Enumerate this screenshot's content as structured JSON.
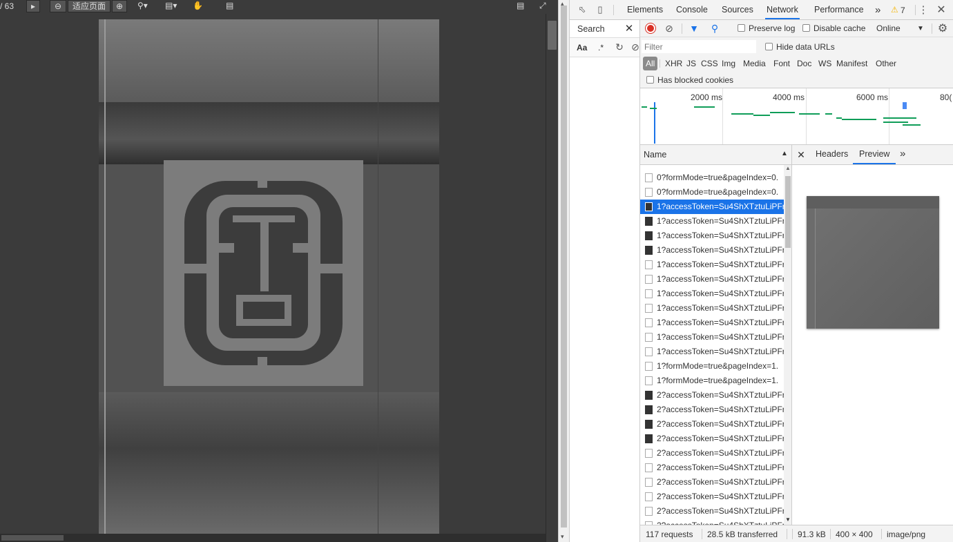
{
  "viewer": {
    "page_indicator": "/ 63",
    "zoom_mode": "适应页面"
  },
  "devtools": {
    "tabs": [
      "Elements",
      "Console",
      "Sources",
      "Network",
      "Performance"
    ],
    "active_tab": "Network",
    "more_tabs": "»",
    "warning_count": "7",
    "search_pane": {
      "title": "Search",
      "case_toggle": "Aa",
      "regex_toggle": ".*"
    },
    "network": {
      "preserve_log_label": "Preserve log",
      "disable_cache_label": "Disable cache",
      "throttling": "Online",
      "filter_placeholder": "Filter",
      "hide_data_urls_label": "Hide data URLs",
      "types": [
        "All",
        "XHR",
        "JS",
        "CSS",
        "Img",
        "Media",
        "Font",
        "Doc",
        "WS",
        "Manifest",
        "Other"
      ],
      "active_type": "All",
      "blocked_cookies_label": "Has blocked cookies",
      "timeline_labels": [
        "2000 ms",
        "4000 ms",
        "6000 ms",
        "80("
      ],
      "name_header": "Name",
      "requests": [
        {
          "name": "0?formMode=true&pageIndex=0.",
          "icon": "doc"
        },
        {
          "name": "0?formMode=true&pageIndex=0.",
          "icon": "doc"
        },
        {
          "name": "1?accessToken=Su4ShXTztuLiPFr5",
          "icon": "dark",
          "selected": true
        },
        {
          "name": "1?accessToken=Su4ShXTztuLiPFr5",
          "icon": "dark"
        },
        {
          "name": "1?accessToken=Su4ShXTztuLiPFr5",
          "icon": "dark"
        },
        {
          "name": "1?accessToken=Su4ShXTztuLiPFr5",
          "icon": "dark"
        },
        {
          "name": "1?accessToken=Su4ShXTztuLiPFr5",
          "icon": "img"
        },
        {
          "name": "1?accessToken=Su4ShXTztuLiPFr5",
          "icon": "img"
        },
        {
          "name": "1?accessToken=Su4ShXTztuLiPFr5",
          "icon": "doc"
        },
        {
          "name": "1?accessToken=Su4ShXTztuLiPFr5",
          "icon": "img"
        },
        {
          "name": "1?accessToken=Su4ShXTztuLiPFr5",
          "icon": "doc"
        },
        {
          "name": "1?accessToken=Su4ShXTztuLiPFr5",
          "icon": "doc"
        },
        {
          "name": "1?accessToken=Su4ShXTztuLiPFr5",
          "icon": "doc"
        },
        {
          "name": "1?formMode=true&pageIndex=1.",
          "icon": "doc"
        },
        {
          "name": "1?formMode=true&pageIndex=1.",
          "icon": "doc"
        },
        {
          "name": "2?accessToken=Su4ShXTztuLiPFr5",
          "icon": "dark"
        },
        {
          "name": "2?accessToken=Su4ShXTztuLiPFr5",
          "icon": "dark"
        },
        {
          "name": "2?accessToken=Su4ShXTztuLiPFr5",
          "icon": "dark"
        },
        {
          "name": "2?accessToken=Su4ShXTztuLiPFr5",
          "icon": "dark"
        },
        {
          "name": "2?accessToken=Su4ShXTztuLiPFr5",
          "icon": "img"
        },
        {
          "name": "2?accessToken=Su4ShXTztuLiPFr5",
          "icon": "img"
        },
        {
          "name": "2?accessToken=Su4ShXTztuLiPFr5",
          "icon": "img"
        },
        {
          "name": "2?accessToken=Su4ShXTztuLiPFr5",
          "icon": "img"
        },
        {
          "name": "2?accessToken=Su4ShXTztuLiPFr5",
          "icon": "img"
        },
        {
          "name": "2?accessToken=Su4ShXTztuLiPFr5",
          "icon": "doc"
        }
      ],
      "detail_tabs": [
        "Headers",
        "Preview"
      ],
      "active_detail_tab": "Preview",
      "status": {
        "requests": "117 requests",
        "transferred": "28.5 kB transferred",
        "size": "91.3 kB",
        "dimensions": "400 × 400",
        "mime": "image/png"
      }
    }
  },
  "colors": {
    "accent": "#1a73e8",
    "record": "#d93025",
    "timeline_bar": "#0f9d58"
  }
}
